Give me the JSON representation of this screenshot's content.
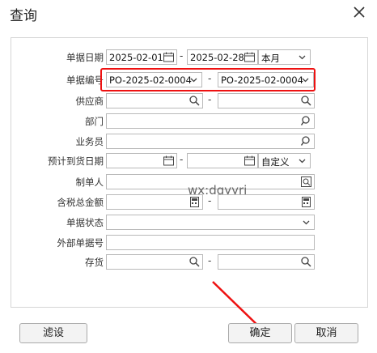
{
  "window": {
    "title": "查询"
  },
  "labels": {
    "doc_date": "单据日期",
    "doc_no": "单据编号",
    "supplier": "供应商",
    "department": "部门",
    "salesperson": "业务员",
    "expected_arrival": "预计到货日期",
    "creator": "制单人",
    "total_tax": "含税总金额",
    "doc_status": "单据状态",
    "external_no": "外部单据号",
    "inventory": "存货"
  },
  "fields": {
    "date_from": "2025-02-01",
    "date_to": "2025-02-28",
    "date_range": "本月",
    "doc_no_from": "PO-2025-02-0004",
    "doc_no_to": "PO-2025-02-0004",
    "arrival_range": "自定义"
  },
  "separator": "-",
  "watermark": "wx:dgyyrj",
  "buttons": {
    "filter": "滤设",
    "ok": "确定",
    "cancel": "取消"
  },
  "colors": {
    "highlight": "#ee1111",
    "annotation_arrow": "#e11"
  },
  "icons": [
    "calendar-icon",
    "search-icon",
    "chevron-down-icon",
    "calculator-icon",
    "close-icon"
  ]
}
